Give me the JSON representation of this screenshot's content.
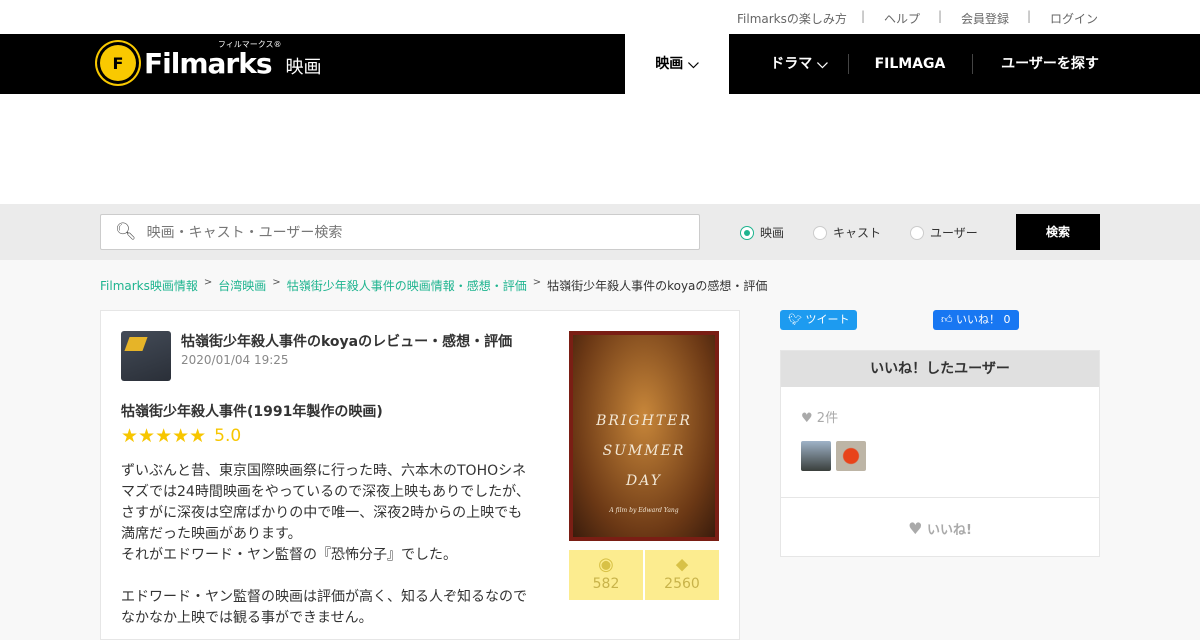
{
  "util_links": [
    "Filmarksの楽しみ方",
    "ヘルプ",
    "会員登録",
    "ログイン"
  ],
  "logo": {
    "brand": "Filmarks",
    "ruby": "フィルマークス®",
    "sub": "映画",
    "mark": "F"
  },
  "nav": [
    {
      "label": "映画 ⌵"
    },
    {
      "label": "ドラマ ⌵"
    },
    {
      "label": "FILMAGA"
    },
    {
      "label": "ユーザーを探す"
    }
  ],
  "search": {
    "placeholder": "映画・キャスト・ユーザー検索",
    "options": [
      "映画",
      "キャスト",
      "ユーザー"
    ],
    "selected": "映画",
    "button": "検索"
  },
  "breadcrumb": [
    "Filmarks映画情報",
    "台湾映画",
    "牯嶺街少年殺人事件の映画情報・感想・評価",
    "牯嶺街少年殺人事件のkoyaの感想・評価"
  ],
  "review": {
    "title": "牯嶺街少年殺人事件のkoyaのレビュー・感想・評価",
    "date": "2020/01/04 19:25",
    "movie": "牯嶺街少年殺人事件(1991年製作の映画)",
    "stars": "★★★★★",
    "rating": "5.0",
    "body": "ずいぶんと昔、東京国際映画祭に行った時、六本木のTOHOシネマズでは24時間映画をやっているので深夜上映もありでしたが、さすがに深夜は空席ばかりの中で唯一、深夜2時からの上映でも満席だった映画があります。\nそれがエドワード・ヤン監督の『恐怖分子』でした。\n\nエドワード・ヤン監督の映画は評価が高く、知る人ぞ知るなのでなかなか上映では観る事ができません。"
  },
  "poster": {
    "lines": [
      "BRIGHTER",
      "SUMMER",
      "DAY"
    ],
    "credit": "A film by Edward Yang"
  },
  "stats": {
    "watched": "582",
    "clipped": "2560"
  },
  "share": {
    "tweet": "ツイート",
    "fb": "いいね！ 0"
  },
  "likes": {
    "header": "いいね！したユーザー",
    "count": "2件",
    "button": "いいね!"
  },
  "colors": {
    "accent": "#1eb48f",
    "nav_bg": "#000000",
    "star": "#f7c600",
    "stat_bg": "#fcec8f"
  }
}
